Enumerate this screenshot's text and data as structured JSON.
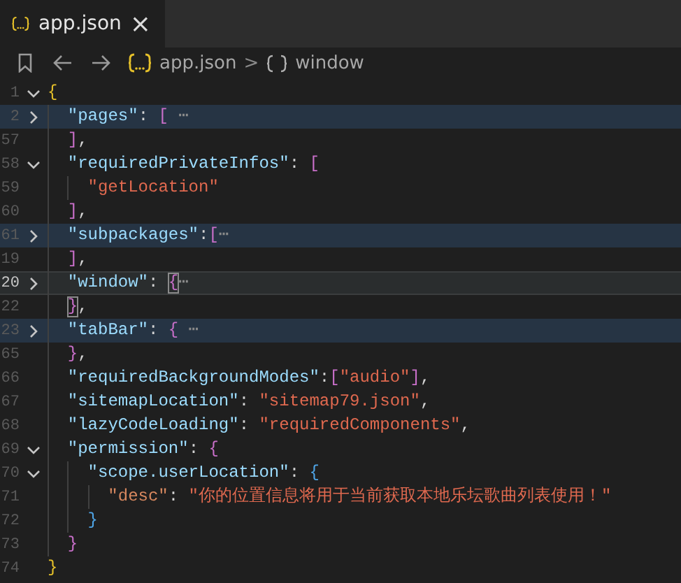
{
  "tab": {
    "title": "app.json",
    "close": "×",
    "selected": true
  },
  "breadcrumb": {
    "file": "app.json",
    "separator": ">",
    "symbol": "window"
  },
  "lines": [
    {
      "number": "1",
      "collapsed": false,
      "highlighted": false,
      "current": false,
      "tokens": [
        {
          "text": "{",
          "kind": "opener",
          "color": "#e5c02a"
        }
      ]
    },
    {
      "number": "2",
      "collapsed": true,
      "highlighted": true,
      "current": false,
      "tokens": [
        {
          "text": "\"pages\"",
          "kind": "key"
        },
        {
          "text": ": ",
          "kind": "punct"
        },
        {
          "text": "[",
          "kind": "opener",
          "color": "#c86fc9"
        },
        {
          "text": " ⋯",
          "kind": "ellipsis"
        }
      ]
    },
    {
      "number": "57",
      "highlighted": false,
      "current": false,
      "tokens": [
        {
          "text": "]",
          "kind": "closer",
          "color": "#c86fc9"
        },
        {
          "text": ",",
          "kind": "punct"
        }
      ]
    },
    {
      "number": "58",
      "collapsed": false,
      "highlighted": false,
      "current": false,
      "tokens": [
        {
          "text": "\"requiredPrivateInfos\"",
          "kind": "key"
        },
        {
          "text": ": ",
          "kind": "punct"
        },
        {
          "text": "[",
          "kind": "opener",
          "color": "#c86fc9"
        }
      ]
    },
    {
      "number": "59",
      "highlighted": false,
      "current": false,
      "tokens": [
        {
          "text": "\"getLocation\"",
          "kind": "string"
        }
      ]
    },
    {
      "number": "60",
      "highlighted": false,
      "current": false,
      "tokens": [
        {
          "text": "]",
          "kind": "closer",
          "color": "#c86fc9"
        },
        {
          "text": ",",
          "kind": "punct"
        }
      ]
    },
    {
      "number": "61",
      "collapsed": true,
      "highlighted": true,
      "current": false,
      "tokens": [
        {
          "text": "\"subpackages\"",
          "kind": "key"
        },
        {
          "text": ":",
          "kind": "punct"
        },
        {
          "text": "[",
          "kind": "opener",
          "color": "#c86fc9"
        },
        {
          "text": "⋯",
          "kind": "ellipsis"
        }
      ]
    },
    {
      "number": "19",
      "highlighted": false,
      "current": false,
      "tokens": [
        {
          "text": "]",
          "kind": "closer",
          "color": "#c86fc9"
        },
        {
          "text": ",",
          "kind": "punct"
        }
      ]
    },
    {
      "number": "20",
      "collapsed": true,
      "highlighted": false,
      "current": true,
      "tokens": [
        {
          "text": "\"window\"",
          "kind": "key"
        },
        {
          "text": ": ",
          "kind": "punct"
        },
        {
          "text": "{",
          "kind": "opener",
          "color": "#c86fc9",
          "matched": true
        },
        {
          "text": "⋯",
          "kind": "ellipsis"
        }
      ]
    },
    {
      "number": "22",
      "highlighted": false,
      "current": false,
      "tokens": [
        {
          "text": "}",
          "kind": "closer",
          "color": "#c86fc9",
          "matched": true
        },
        {
          "text": ",",
          "kind": "punct"
        }
      ]
    },
    {
      "number": "23",
      "collapsed": true,
      "highlighted": true,
      "current": false,
      "tokens": [
        {
          "text": "\"tabBar\"",
          "kind": "key"
        },
        {
          "text": ": ",
          "kind": "punct"
        },
        {
          "text": "{",
          "kind": "opener",
          "color": "#c86fc9"
        },
        {
          "text": " ⋯",
          "kind": "ellipsis"
        }
      ]
    },
    {
      "number": "65",
      "highlighted": false,
      "current": false,
      "tokens": [
        {
          "text": "}",
          "kind": "closer",
          "color": "#c86fc9"
        },
        {
          "text": ",",
          "kind": "punct"
        }
      ]
    },
    {
      "number": "66",
      "highlighted": false,
      "current": false,
      "tokens": [
        {
          "text": "\"requiredBackgroundModes\"",
          "kind": "key"
        },
        {
          "text": ":",
          "kind": "punct"
        },
        {
          "text": "[",
          "kind": "opener",
          "color": "#c86fc9"
        },
        {
          "text": "\"audio\"",
          "kind": "string"
        },
        {
          "text": "]",
          "kind": "closer",
          "color": "#c86fc9"
        },
        {
          "text": ",",
          "kind": "punct"
        }
      ]
    },
    {
      "number": "67",
      "highlighted": false,
      "current": false,
      "tokens": [
        {
          "text": "\"sitemapLocation\"",
          "kind": "key"
        },
        {
          "text": ": ",
          "kind": "punct"
        },
        {
          "text": "\"sitemap79.json\"",
          "kind": "string"
        },
        {
          "text": ",",
          "kind": "punct"
        }
      ]
    },
    {
      "number": "68",
      "highlighted": false,
      "current": false,
      "tokens": [
        {
          "text": "\"lazyCodeLoading\"",
          "kind": "key"
        },
        {
          "text": ": ",
          "kind": "punct"
        },
        {
          "text": "\"requiredComponents\"",
          "kind": "string"
        },
        {
          "text": ",",
          "kind": "punct"
        }
      ]
    },
    {
      "number": "69",
      "collapsed": false,
      "highlighted": false,
      "current": false,
      "tokens": [
        {
          "text": "\"permission\"",
          "kind": "key"
        },
        {
          "text": ": ",
          "kind": "punct"
        },
        {
          "text": "{",
          "kind": "opener",
          "color": "#c86fc9"
        }
      ]
    },
    {
      "number": "70",
      "collapsed": false,
      "highlighted": false,
      "current": false,
      "tokens": [
        {
          "text": "\"scope.userLocation\"",
          "kind": "key"
        },
        {
          "text": ": ",
          "kind": "punct"
        },
        {
          "text": "{",
          "kind": "opener",
          "color": "#4fa6e8"
        }
      ]
    },
    {
      "number": "71",
      "highlighted": false,
      "current": false,
      "tokens": [
        {
          "text": "\"desc\"",
          "kind": "deepkey"
        },
        {
          "text": ": ",
          "kind": "punct"
        },
        {
          "text": "\"你的位置信息将用于当前获取本地乐坛歌曲列表使用！\"",
          "kind": "string"
        }
      ]
    },
    {
      "number": "72",
      "highlighted": false,
      "current": false,
      "tokens": [
        {
          "text": "}",
          "kind": "closer",
          "color": "#4fa6e8"
        }
      ]
    },
    {
      "number": "73",
      "highlighted": false,
      "current": false,
      "tokens": [
        {
          "text": "}",
          "kind": "closer",
          "color": "#c86fc9"
        }
      ]
    },
    {
      "number": "74",
      "highlighted": false,
      "current": false,
      "tokens": [
        {
          "text": "}",
          "kind": "closer",
          "color": "#e5c02a"
        }
      ]
    }
  ]
}
